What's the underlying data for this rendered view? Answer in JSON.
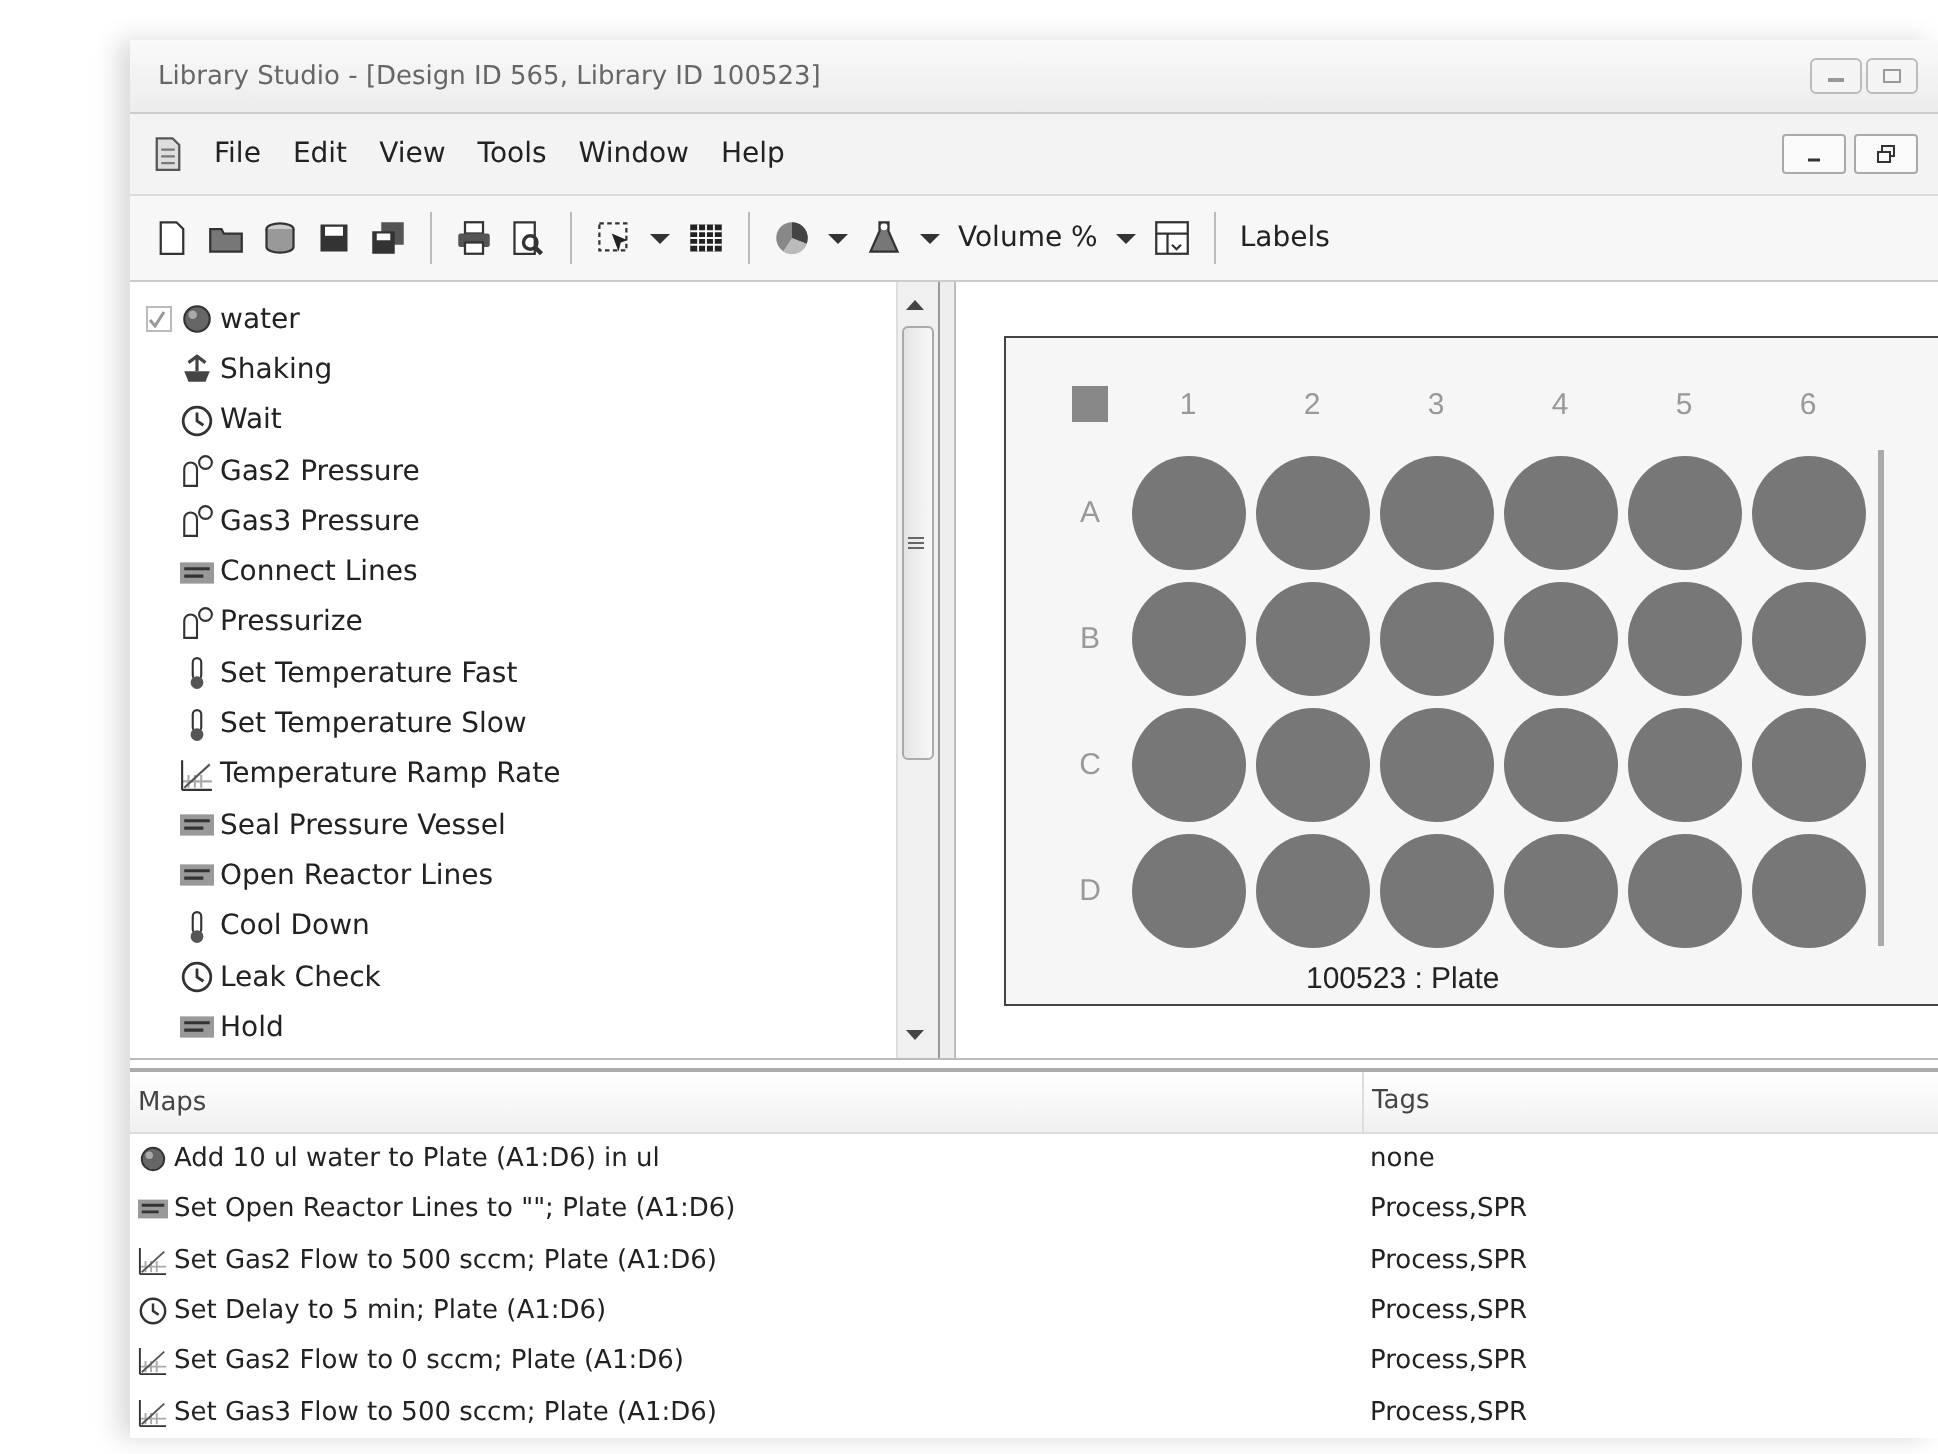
{
  "window": {
    "title": "Library Studio - [Design ID 565, Library ID 100523]"
  },
  "menu": [
    "File",
    "Edit",
    "View",
    "Tools",
    "Window",
    "Help"
  ],
  "toolbar": [
    {
      "kind": "new"
    },
    {
      "kind": "open"
    },
    {
      "kind": "database"
    },
    {
      "kind": "save"
    },
    {
      "kind": "save-all"
    },
    {
      "kind": "sep"
    },
    {
      "kind": "print"
    },
    {
      "kind": "preview"
    },
    {
      "kind": "sep"
    },
    {
      "kind": "select"
    },
    {
      "kind": "caret"
    },
    {
      "kind": "grid"
    },
    {
      "kind": "sep"
    },
    {
      "kind": "pie"
    },
    {
      "kind": "caret"
    },
    {
      "kind": "flask"
    },
    {
      "kind": "caret"
    },
    {
      "kind": "text",
      "label": "Volume %"
    },
    {
      "kind": "caret"
    },
    {
      "kind": "layout"
    },
    {
      "kind": "sep"
    },
    {
      "kind": "text",
      "label": "Labels"
    }
  ],
  "process_list": [
    {
      "label": "water",
      "kind": "sample",
      "checked": true
    },
    {
      "label": "Shaking",
      "kind": "shaking"
    },
    {
      "label": "Wait",
      "kind": "clock"
    },
    {
      "label": "Gas2 Pressure",
      "kind": "gas"
    },
    {
      "label": "Gas3 Pressure",
      "kind": "gas"
    },
    {
      "label": "Connect Lines",
      "kind": "text"
    },
    {
      "label": "Pressurize",
      "kind": "gas"
    },
    {
      "label": "Set Temperature Fast",
      "kind": "thermometer"
    },
    {
      "label": "Set Temperature Slow",
      "kind": "thermometer"
    },
    {
      "label": "Temperature Ramp Rate",
      "kind": "ramp"
    },
    {
      "label": "Seal Pressure Vessel",
      "kind": "text"
    },
    {
      "label": "Open Reactor Lines",
      "kind": "text"
    },
    {
      "label": "Cool Down",
      "kind": "thermometer"
    },
    {
      "label": "Leak Check",
      "kind": "clock"
    },
    {
      "label": "Hold",
      "kind": "text"
    }
  ],
  "plate": {
    "column_labels": [
      "1",
      "2",
      "3",
      "4",
      "5",
      "6"
    ],
    "row_labels": [
      "A",
      "B",
      "C",
      "D"
    ],
    "caption": "100523 : Plate"
  },
  "maps": {
    "columns": [
      "Maps",
      "Tags"
    ],
    "rows": [
      {
        "kind": "sample",
        "text": "Add 10 ul water to Plate (A1:D6) in ul",
        "tags": "none"
      },
      {
        "kind": "text",
        "text": "Set Open Reactor Lines to \"\"; Plate (A1:D6)",
        "tags": "Process,SPR"
      },
      {
        "kind": "ramp",
        "text": "Set Gas2 Flow to 500 sccm; Plate (A1:D6)",
        "tags": "Process,SPR"
      },
      {
        "kind": "clock",
        "text": "Set Delay to 5 min; Plate (A1:D6)",
        "tags": "Process,SPR"
      },
      {
        "kind": "ramp",
        "text": "Set Gas2 Flow to 0 sccm; Plate (A1:D6)",
        "tags": "Process,SPR"
      },
      {
        "kind": "ramp",
        "text": "Set Gas3 Flow to 500 sccm; Plate (A1:D6)",
        "tags": "Process,SPR"
      }
    ]
  }
}
